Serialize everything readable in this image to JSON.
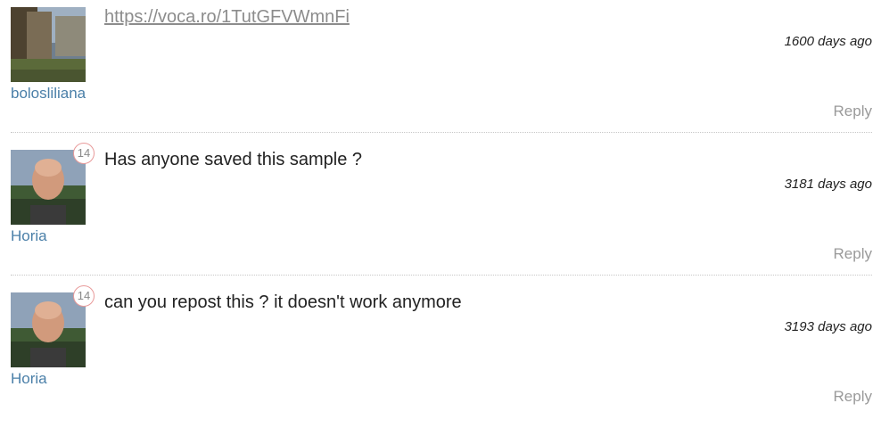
{
  "comments": [
    {
      "username": "bolosliliana",
      "text": "https://voca.ro/1TutGFVWmnFi",
      "is_link": true,
      "time_ago": "1600 days ago",
      "reply_label": "Reply",
      "badge": null
    },
    {
      "username": "Horia",
      "text": "Has anyone saved this sample ?",
      "is_link": false,
      "time_ago": "3181 days ago",
      "reply_label": "Reply",
      "badge": "14"
    },
    {
      "username": "Horia",
      "text": "can you repost this ? it doesn't work anymore",
      "is_link": false,
      "time_ago": "3193 days ago",
      "reply_label": "Reply",
      "badge": "14"
    }
  ],
  "colors": {
    "username": "#4a7fa8",
    "link": "#8c8c8c",
    "reply": "#9a9a9a",
    "badge_border": "#e89a9a"
  }
}
